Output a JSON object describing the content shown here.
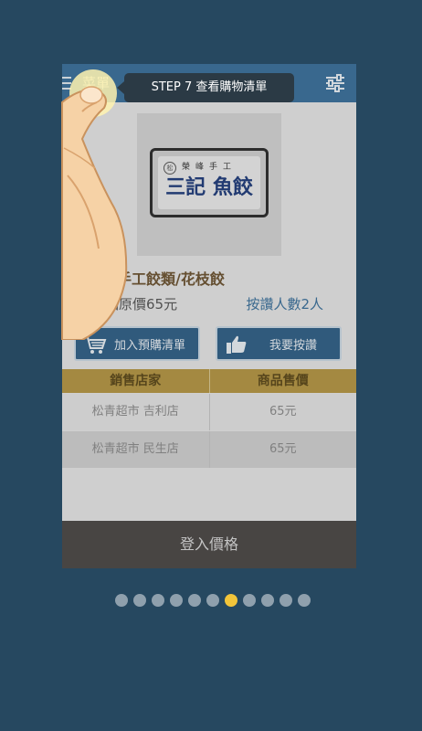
{
  "app": {
    "title": "菜單",
    "menu_icon": "menu-icon",
    "filter_icon": "sliders-icon"
  },
  "tutorial": {
    "tooltip": "STEP 7  查看購物清單",
    "step_index": 7,
    "total_steps": 11
  },
  "product": {
    "pack_top": "榮峰手工",
    "pack_brand": "三記 魚餃",
    "pack_logo": "松",
    "name": "手工餃類/花枝餃",
    "original_price": "商品原價65元",
    "likes": "按讚人數2人"
  },
  "actions": {
    "add_to_list": "加入預購清單",
    "like": "我要按讚"
  },
  "table": {
    "headers": [
      "銷售店家",
      "商品售價"
    ],
    "rows": [
      {
        "store": "松青超市 吉利店",
        "price": "65元"
      },
      {
        "store": "松青超市 民生店",
        "price": "65元"
      }
    ]
  },
  "footer": {
    "login_label": "登入價格"
  },
  "colors": {
    "background": "#264860",
    "appbar": "#3a6f9a",
    "table_header": "#b39543",
    "active_dot": "#f2c53a"
  }
}
